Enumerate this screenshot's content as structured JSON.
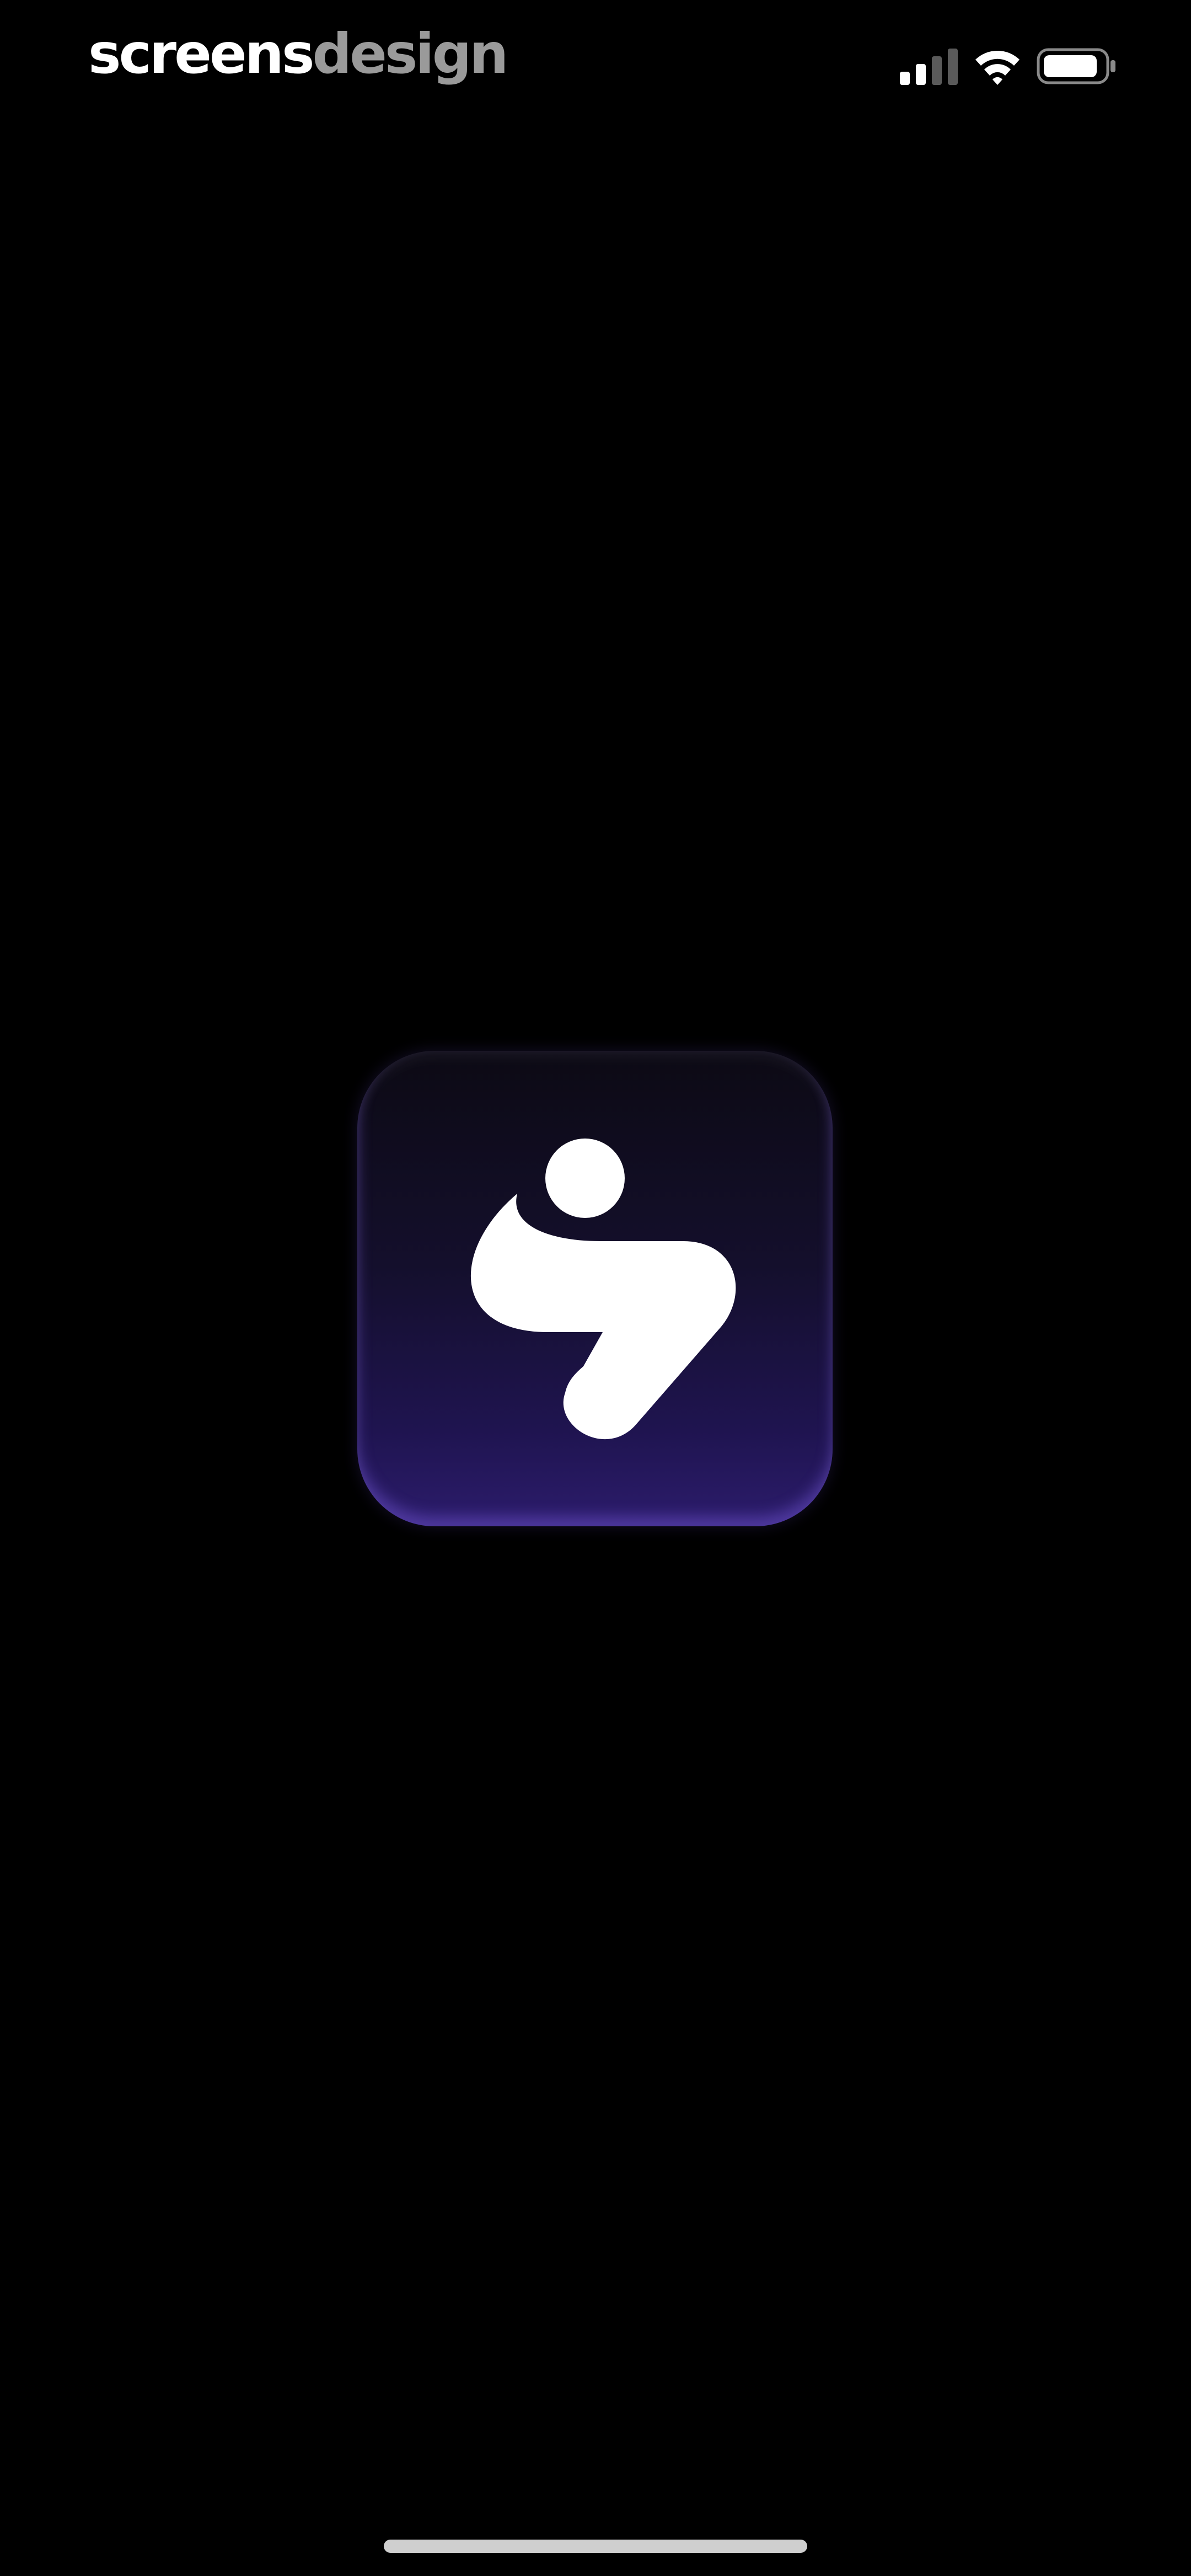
{
  "watermark": {
    "part1": "screens",
    "part2": "design"
  },
  "status_bar": {
    "icons": [
      "signal-icon",
      "wifi-icon",
      "battery-icon"
    ]
  },
  "splash": {
    "logo_icon": "app-logo-icon",
    "colors": {
      "background": "#000000",
      "logo_top": "#0c0a14",
      "logo_bottom": "#2c1c6c",
      "mark": "#ffffff"
    }
  }
}
